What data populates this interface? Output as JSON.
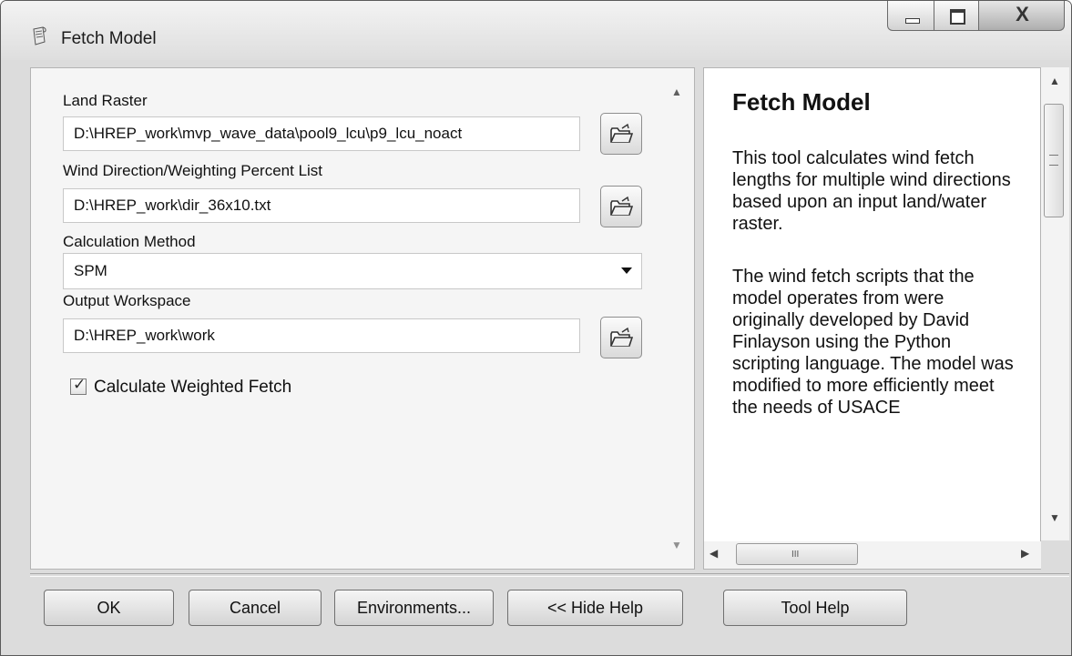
{
  "window": {
    "title": "Fetch Model",
    "icon": "script-tool-icon",
    "controls": {
      "minimize_icon": "minimize-icon",
      "maximize_icon": "maximize-icon",
      "close_label": "X"
    }
  },
  "params": {
    "land_raster": {
      "label": "Land Raster",
      "value": "D:\\HREP_work\\mvp_wave_data\\pool9_lcu\\p9_lcu_noact"
    },
    "wind_direction": {
      "label": "Wind Direction/Weighting Percent List",
      "value": "D:\\HREP_work\\dir_36x10.txt"
    },
    "calculation_method": {
      "label": "Calculation Method",
      "selected": "SPM"
    },
    "output_workspace": {
      "label": "Output Workspace",
      "value": "D:\\HREP_work\\work"
    },
    "weighted_fetch": {
      "label": "Calculate Weighted Fetch",
      "checked": true
    }
  },
  "help": {
    "title": "Fetch Model",
    "paragraphs": [
      "This tool calculates wind fetch lengths for multiple wind directions based upon an input land/water raster.",
      "The wind fetch scripts that the model operates from were originally developed by David Finlayson using the Python scripting language. The model was modified to more efficiently meet the needs of USACE"
    ],
    "hscroll_grip": "III"
  },
  "buttons": {
    "ok": "OK",
    "cancel": "Cancel",
    "environments": "Environments...",
    "hide_help": "<< Hide Help",
    "tool_help": "Tool Help"
  }
}
